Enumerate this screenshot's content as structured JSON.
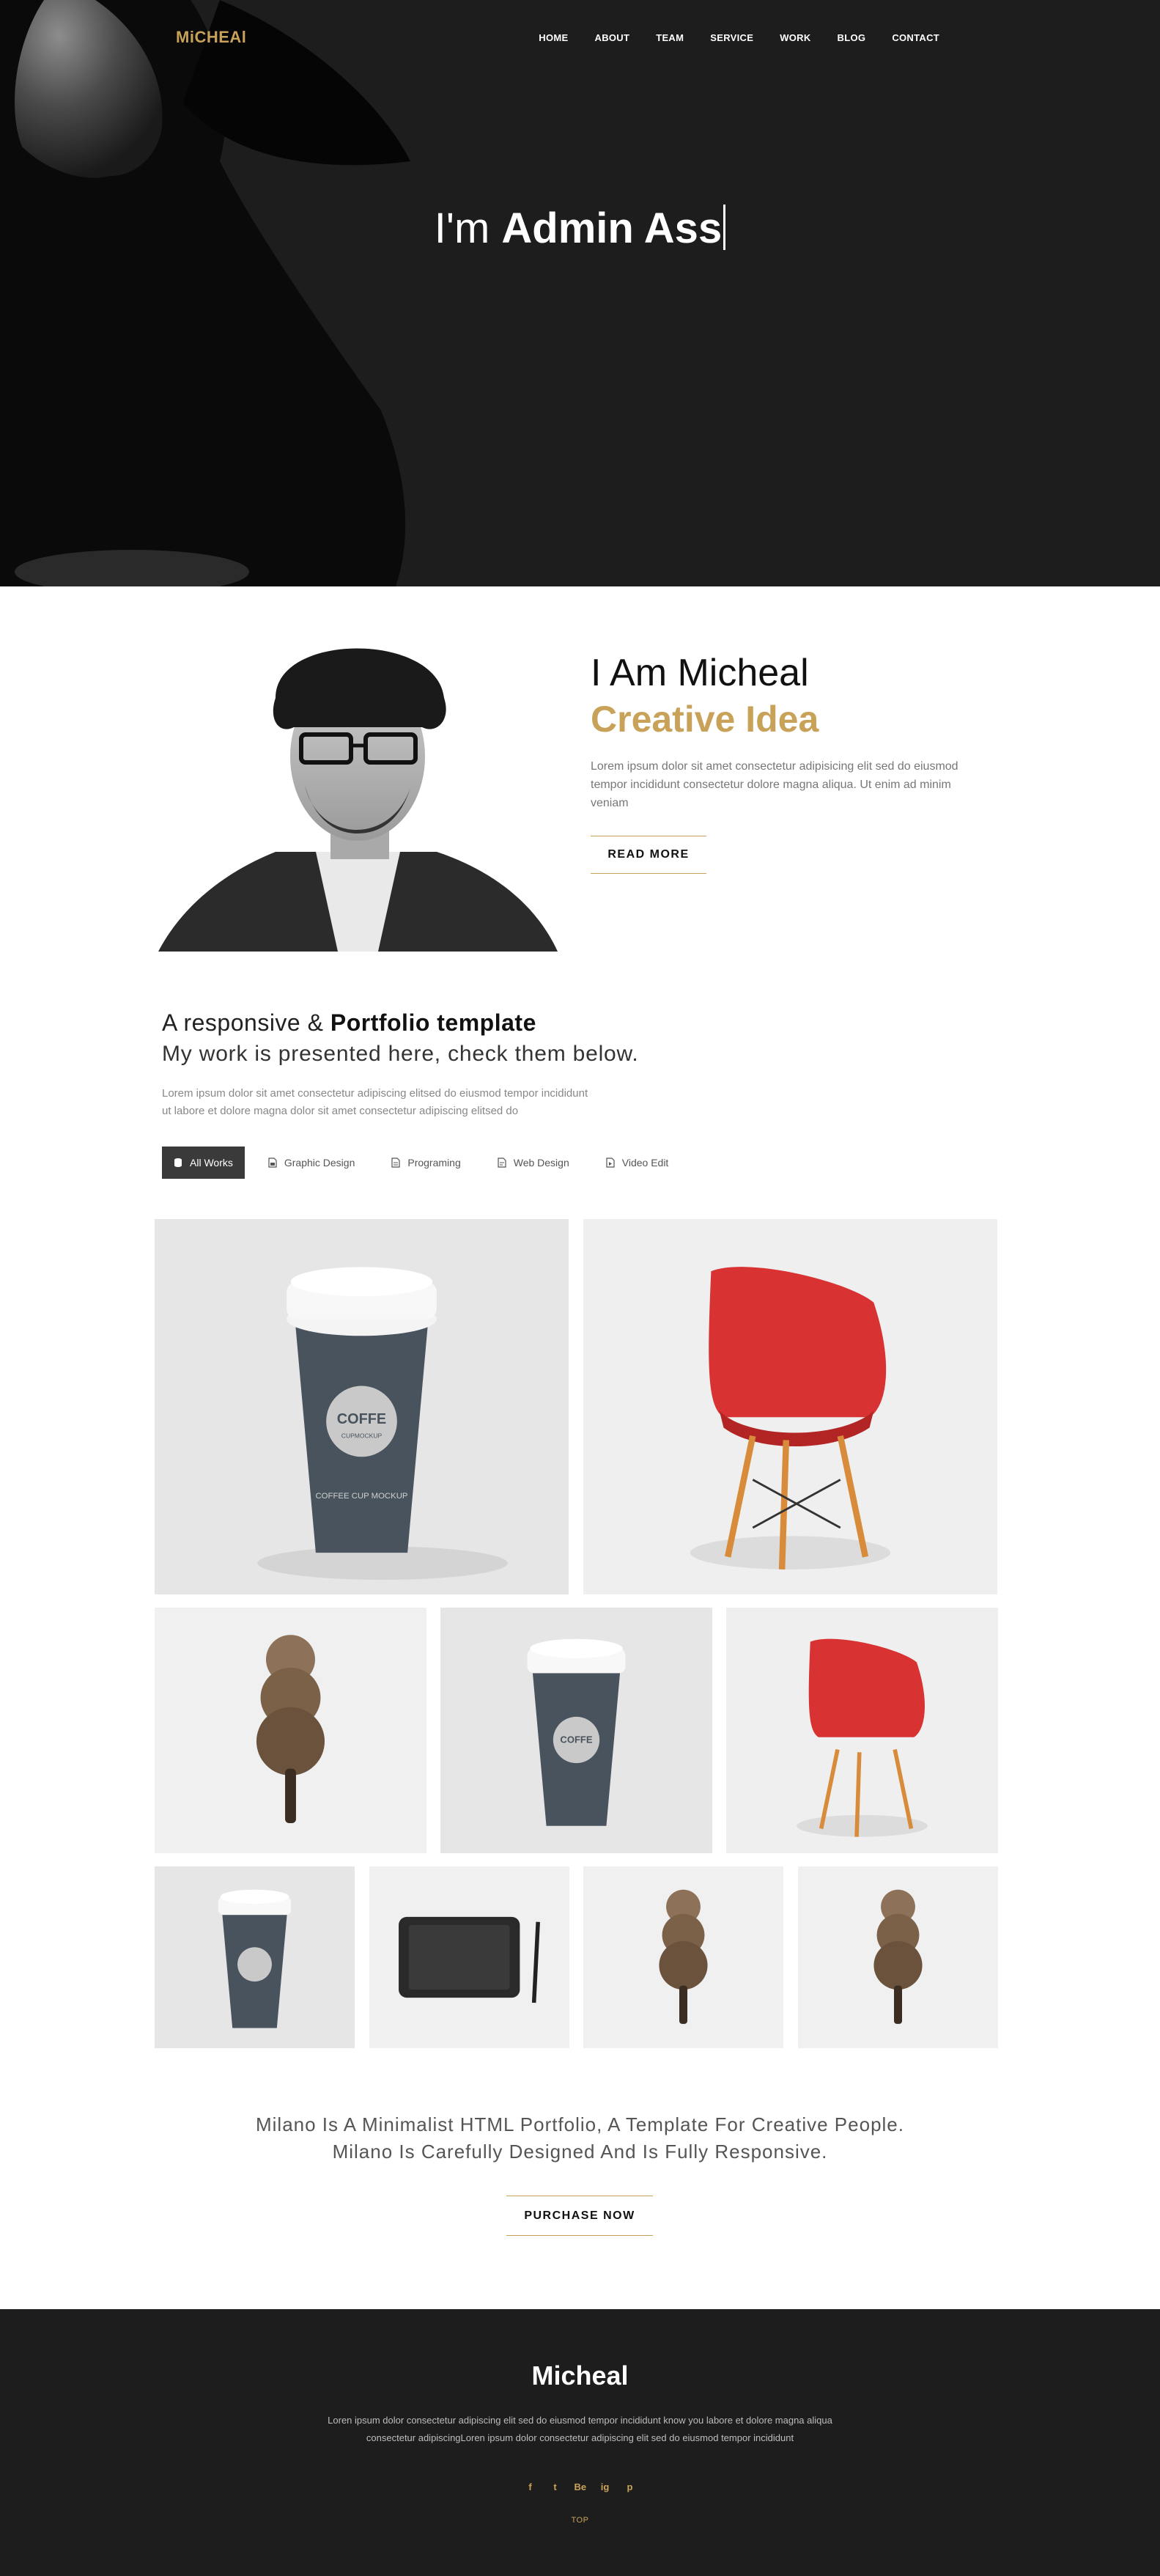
{
  "header": {
    "logo": "MiCHEAl",
    "nav": [
      "HOME",
      "ABOUT",
      "TEAM",
      "SERVICE",
      "WORK",
      "BLOG",
      "CONTACT"
    ]
  },
  "hero": {
    "prefix": "I'm ",
    "name": "Admin Ass"
  },
  "about": {
    "title": "I Am Micheal",
    "subtitle": "Creative Idea",
    "text": "Lorem ipsum dolor sit amet consectetur adipisicing elit sed do eiusmod tempor incididunt consectetur dolore magna aliqua. Ut enim ad minim veniam",
    "button": "READ MORE"
  },
  "portfolio": {
    "line1_prefix": "A responsive & ",
    "line1_bold": "Portfolio template",
    "line2": "My work is presented here, check them below.",
    "desc_line1": "Lorem ipsum dolor sit amet consectetur adipiscing elitsed do eiusmod tempor incididunt",
    "desc_line2": "ut labore et dolore magna dolor sit amet consectetur adipiscing elitsed do",
    "filters": [
      "All Works",
      "Graphic Design",
      "Programing",
      "Web Design",
      "Video Edit"
    ],
    "active_filter": "All Works",
    "mockup_text": {
      "cup_title": "COFFE",
      "cup_sub": "CUPMOCKUP",
      "cup_caption": "COFFEE CUP MOCKUP"
    }
  },
  "promo": {
    "line1": "Milano Is A Minimalist HTML Portfolio, A Template For Creative People.",
    "line2": "Milano Is Carefully Designed And Is Fully Responsive.",
    "button": "PURCHASE NOW"
  },
  "footer": {
    "brand": "Micheal",
    "text": "Loren ipsum dolor consectetur adipiscing elit sed do eiusmod tempor incididunt know you labore et dolore magna aliqua consectetur adipiscingLoren ipsum dolor consectetur adipiscing elit sed do eiusmod tempor incididunt",
    "socials": [
      "f",
      "t",
      "Be",
      "ig",
      "p"
    ],
    "top": "TOP"
  },
  "colors": {
    "accent": "#c9a25a",
    "dark": "#1d1d1d",
    "chair": "#d83232"
  }
}
